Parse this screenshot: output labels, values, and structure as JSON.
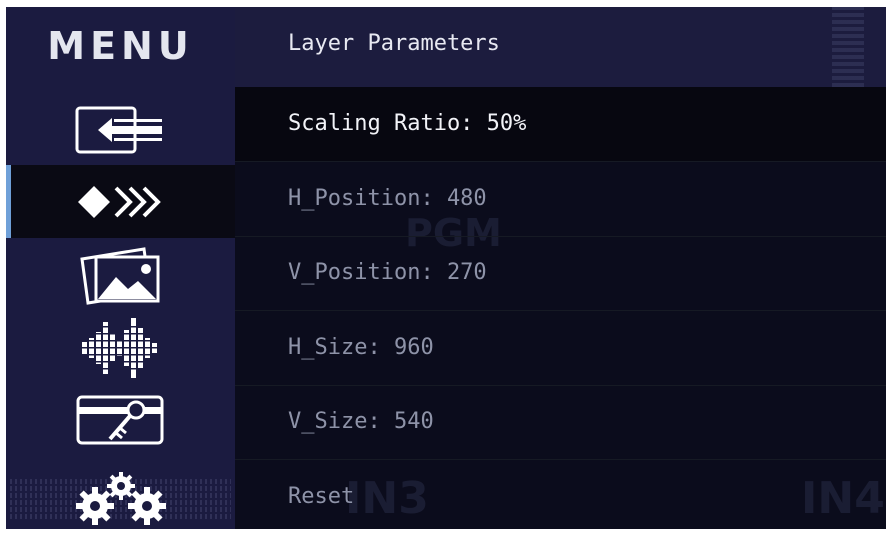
{
  "sidebar": {
    "title": "MENU",
    "items": [
      {
        "icon": "input-source-icon"
      },
      {
        "icon": "layer-switch-icon",
        "active": true
      },
      {
        "icon": "image-gallery-icon"
      },
      {
        "icon": "audio-waveform-icon"
      },
      {
        "icon": "key-card-icon"
      },
      {
        "icon": "settings-gears-icon"
      }
    ]
  },
  "header": {
    "title": "Layer Parameters"
  },
  "parameters": [
    {
      "label": "Scaling Ratio: 50%"
    },
    {
      "label": "H_Position: 480"
    },
    {
      "label": "V_Position: 270"
    },
    {
      "label": "H_Size: 960"
    },
    {
      "label": "V_Size: 540"
    },
    {
      "label": "Reset"
    }
  ],
  "watermarks": {
    "pgm": "PGM",
    "in3": "IN3",
    "in4": "IN4"
  },
  "colors": {
    "sidebar_bg": "#1b1b40",
    "header_bg": "#1c1c3e",
    "panel_bg": "#0b0c1c",
    "active_indicator": "#6fa0d8",
    "text_primary": "#f2f3f8",
    "text_muted": "#8e93a8"
  }
}
